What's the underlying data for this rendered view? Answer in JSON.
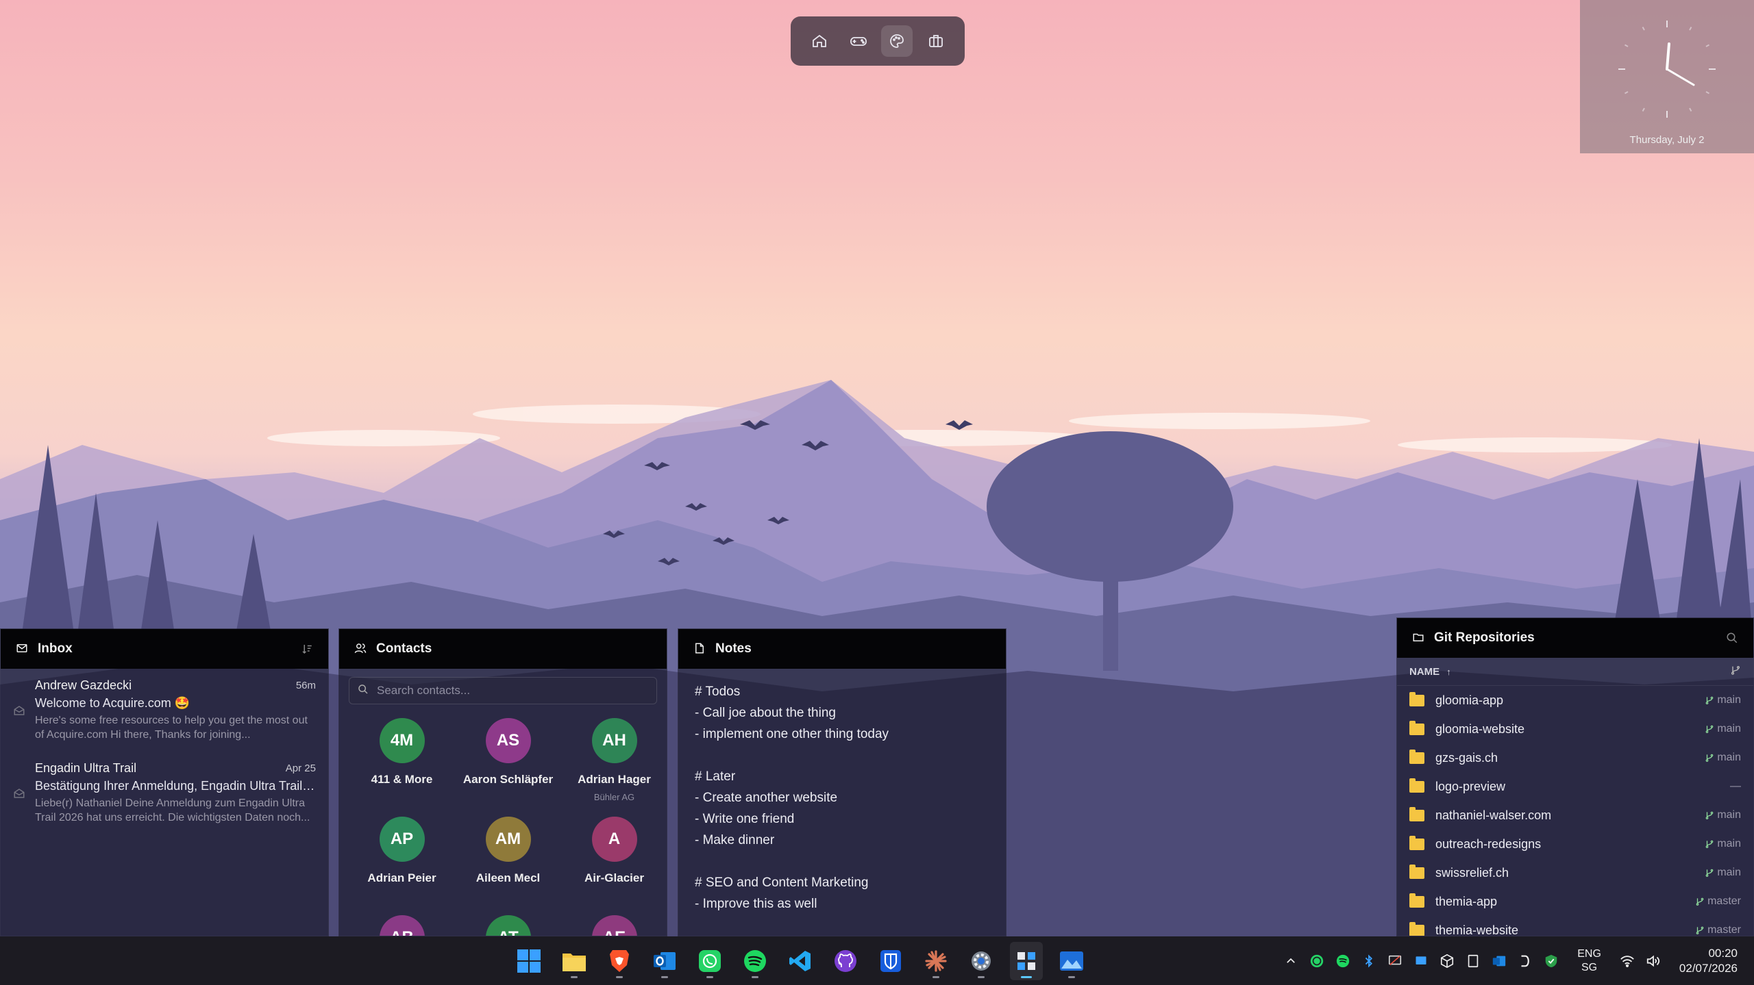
{
  "dock": {
    "items": [
      "home-icon",
      "gamepad-icon",
      "palette-icon",
      "briefcase-icon"
    ],
    "active_index": 2
  },
  "clock": {
    "date": "Thursday, July 2"
  },
  "inbox": {
    "title": "Inbox",
    "messages": [
      {
        "from": "Andrew Gazdecki",
        "time": "56m",
        "subject": "Welcome to Acquire.com 🤩",
        "preview": "Here's some free resources to help you get the most out of Acquire.com Hi there, Thanks for joining..."
      },
      {
        "from": "Engadin Ultra Trail",
        "time": "Apr 25",
        "subject": "Bestätigung Ihrer Anmeldung, Engadin Ultra Trail ...",
        "preview": "Liebe(r) Nathaniel Deine Anmeldung zum Engadin Ultra Trail 2026 hat uns erreicht. Die wichtigsten Daten noch..."
      }
    ]
  },
  "contacts": {
    "title": "Contacts",
    "search_placeholder": "Search contacts...",
    "items": [
      {
        "initials": "4M",
        "name": "411 & More",
        "org": "",
        "color": "#2f8a4e"
      },
      {
        "initials": "AS",
        "name": "Aaron Schläpfer",
        "org": "",
        "color": "#8e3a8a"
      },
      {
        "initials": "AH",
        "name": "Adrian Hager",
        "org": "Bühler AG",
        "color": "#2e8556"
      },
      {
        "initials": "AP",
        "name": "Adrian Peier",
        "org": "",
        "color": "#2d8a5c"
      },
      {
        "initials": "AM",
        "name": "Aileen Mecl",
        "org": "",
        "color": "#8f7a3a"
      },
      {
        "initials": "A",
        "name": "Air-Glacier",
        "org": "",
        "color": "#9a3a6a"
      },
      {
        "initials": "AB",
        "name": "",
        "org": "",
        "color": "#8a3a86"
      },
      {
        "initials": "AT",
        "name": "",
        "org": "",
        "color": "#2e8a4c"
      },
      {
        "initials": "AE",
        "name": "",
        "org": "",
        "color": "#8e3a7e"
      }
    ]
  },
  "notes": {
    "title": "Notes",
    "body": "# Todos\n- Call joe about the thing\n- implement one other thing today\n\n# Later\n- Create another website\n- Write one friend\n- Make dinner\n\n# SEO and Content Marketing\n- Improve this as well"
  },
  "git": {
    "title": "Git Repositories",
    "column_name": "NAME",
    "repos": [
      {
        "name": "gloomia-app",
        "branch": "main"
      },
      {
        "name": "gloomia-website",
        "branch": "main"
      },
      {
        "name": "gzs-gais.ch",
        "branch": "main"
      },
      {
        "name": "logo-preview",
        "branch": "—"
      },
      {
        "name": "nathaniel-walser.com",
        "branch": "main"
      },
      {
        "name": "outreach-redesigns",
        "branch": "main"
      },
      {
        "name": "swissrelief.ch",
        "branch": "main"
      },
      {
        "name": "themia-app",
        "branch": "master"
      },
      {
        "name": "themia-website",
        "branch": "master"
      }
    ]
  },
  "taskbar": {
    "apps": [
      "windows-start-icon",
      "file-explorer-icon",
      "brave-browser-icon",
      "outlook-icon",
      "whatsapp-icon",
      "spotify-icon",
      "vscode-icon",
      "github-desktop-icon",
      "bitwarden-icon",
      "claude-icon",
      "settings-icon",
      "widgets-app-icon",
      "photos-icon"
    ],
    "active_app": "widgets-app-icon",
    "lang": "ENG",
    "region": "SG",
    "time": "00:20",
    "date": "02/07/2026"
  },
  "colors": {
    "accent_blue": "#5cc8ff",
    "folder_yellow": "#f5c542",
    "panel_header": "#050507"
  }
}
